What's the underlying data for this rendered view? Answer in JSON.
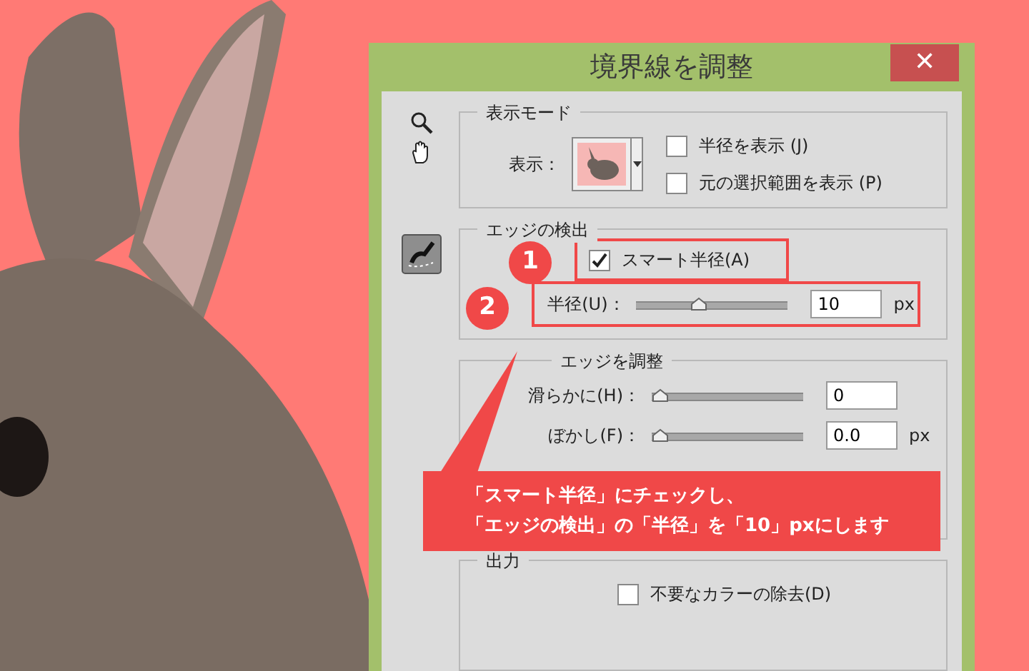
{
  "dialog": {
    "title": "境界線を調整",
    "close": "✕"
  },
  "view_mode": {
    "legend": "表示モード",
    "view_label": "表示：",
    "checkboxes": [
      {
        "label": "半径を表示 (J)",
        "checked": false
      },
      {
        "label": "元の選択範囲を表示 (P)",
        "checked": false
      }
    ]
  },
  "edge_detection": {
    "legend": "エッジの検出",
    "marker": "1",
    "smart_radius": {
      "label": "スマート半径(A)",
      "checked": true
    },
    "radius": {
      "marker": "2",
      "label": "半径(U)：",
      "level": 0.4,
      "value": "10",
      "unit": "px"
    }
  },
  "adjust_edge": {
    "legend": "エッジを調整",
    "sliders": [
      {
        "label": "滑らかに(H)：",
        "level": 0,
        "value": "0"
      },
      {
        "label": "ぼかし(F)：",
        "level": 0,
        "value": "0.0",
        "unit": "px"
      }
    ]
  },
  "callout": {
    "lines": [
      "「スマート半径」にチェックし、",
      "「エッジの検出」の「半径」を「10」pxにします"
    ]
  },
  "output": {
    "legend": "出力",
    "checkboxes": [
      {
        "label": "不要なカラーの除去(D)",
        "checked": false
      }
    ]
  }
}
